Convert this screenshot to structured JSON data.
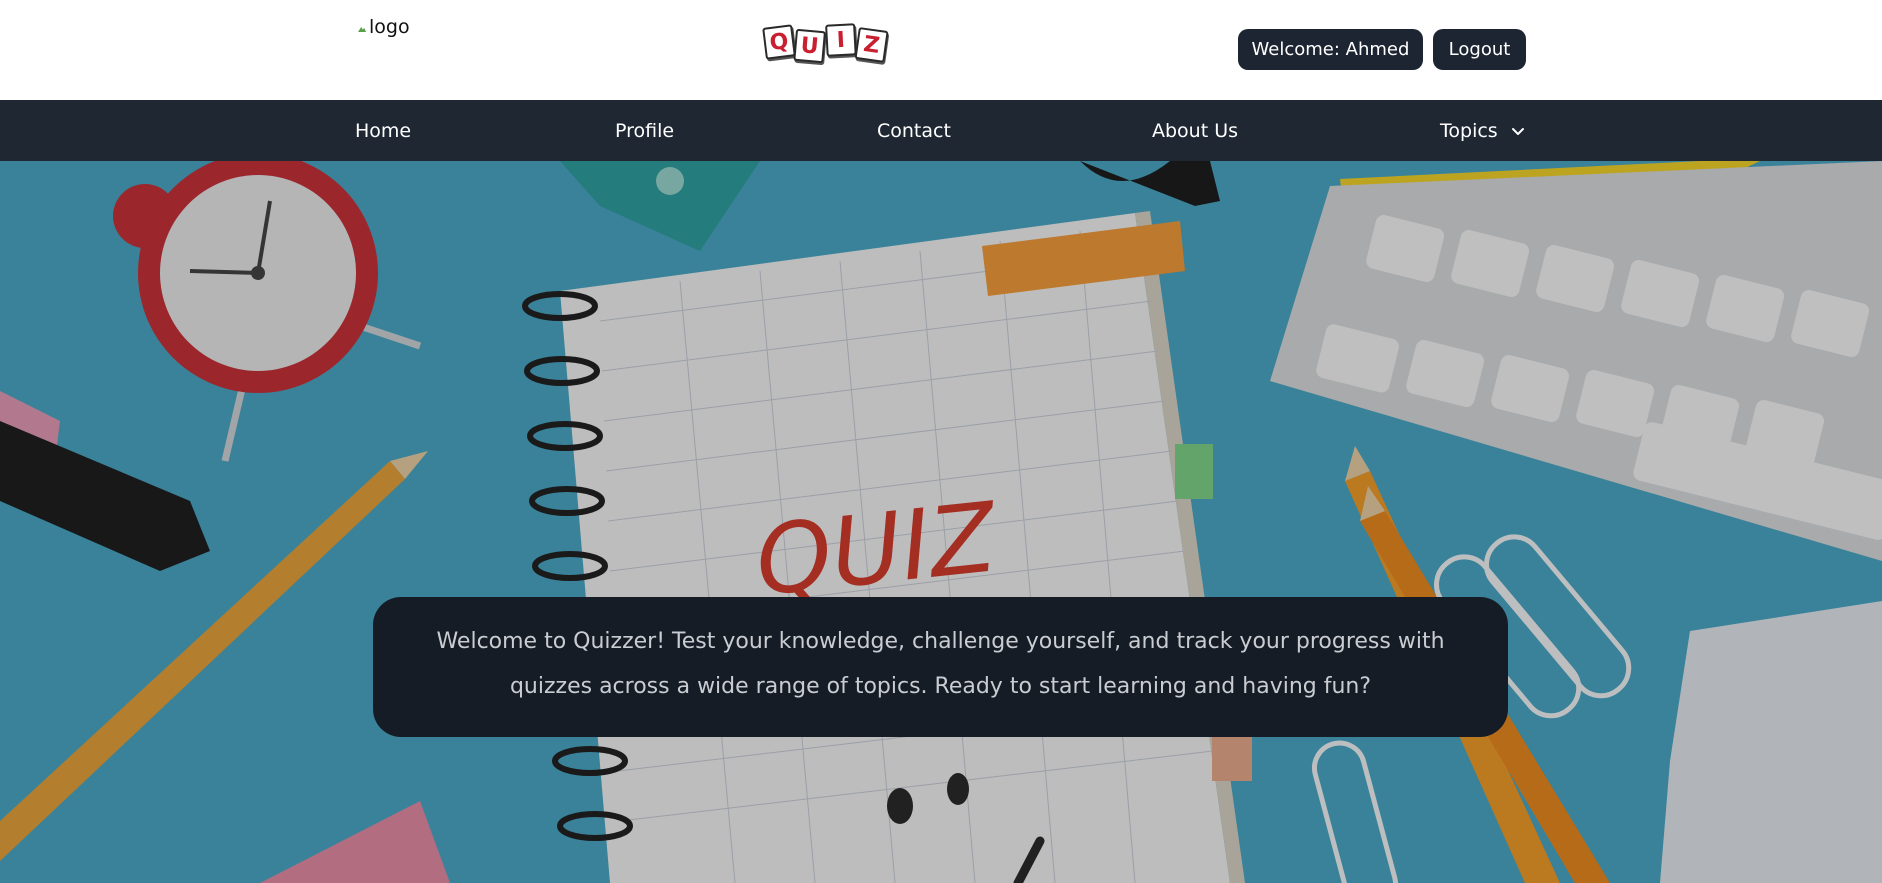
{
  "header": {
    "logo_alt": "logo",
    "brand_letters": [
      "Q",
      "U",
      "I",
      "Z"
    ],
    "welcome_label": "Welcome: Ahmed",
    "logout_label": "Logout"
  },
  "nav": {
    "items": [
      {
        "label": "Home"
      },
      {
        "label": "Profile"
      },
      {
        "label": "Contact"
      },
      {
        "label": "About Us"
      },
      {
        "label": "Topics",
        "icon": "chevron-down-icon"
      }
    ]
  },
  "hero": {
    "notebook_text": "QUIZ",
    "welcome_message": "Welcome to Quizzer! Test your knowledge, challenge yourself, and track your progress with quizzes across a wide range of topics. Ready to start learning and having fun?"
  },
  "colors": {
    "navbar_bg": "#1f2733",
    "pill_bg": "#1e2532",
    "hero_bg": "#4aa7c4",
    "message_box_bg": "#161c26",
    "brand_red": "#c8202f"
  }
}
